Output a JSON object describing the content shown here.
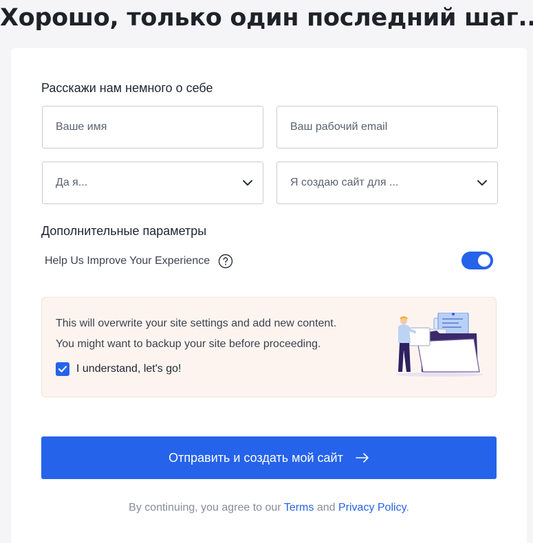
{
  "page": {
    "title": "Хорошо, только один последний шаг..."
  },
  "about": {
    "heading": "Расскажи нам немного о себе",
    "name_placeholder": "Ваше имя",
    "email_placeholder": "Ваш рабочий email",
    "role_select": "Да я...",
    "purpose_select": "Я создаю сайт для ..."
  },
  "advanced": {
    "heading": "Дополнительные параметры",
    "improve_label": "Help Us Improve Your Experience",
    "improve_enabled": true
  },
  "notice": {
    "line1": "This will overwrite your site settings and add new content.",
    "line2": "You might want to backup your site before proceeding.",
    "checkbox_label": "I understand, let's go!",
    "checked": true
  },
  "submit": {
    "label": "Отправить и создать мой сайт"
  },
  "footer": {
    "prefix": "By continuing, you agree to our",
    "terms": "Terms",
    "and": "and",
    "privacy": "Privacy Policy",
    "suffix": "."
  },
  "colors": {
    "accent": "#2563eb",
    "notice_bg": "#fdf4ef"
  }
}
